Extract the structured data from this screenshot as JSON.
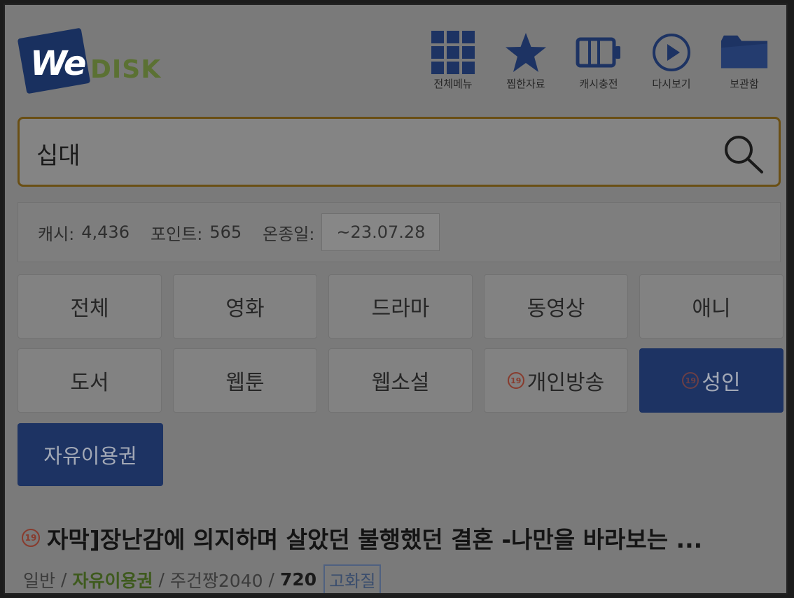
{
  "logo": {
    "we": "We",
    "disk": "DISK"
  },
  "topnav": [
    {
      "label": "전체메뉴",
      "icon": "grid-icon"
    },
    {
      "label": "찜한자료",
      "icon": "star-icon"
    },
    {
      "label": "캐시충전",
      "icon": "battery-icon"
    },
    {
      "label": "다시보기",
      "icon": "play-icon"
    },
    {
      "label": "보관함",
      "icon": "folder-icon"
    }
  ],
  "search": {
    "value": "십대",
    "icon": "search-icon"
  },
  "account": {
    "cash_label": "캐시:",
    "cash_value": "4,436",
    "point_label": "포인트:",
    "point_value": "565",
    "term_label": "온종일:",
    "term_value": "~23.07.28"
  },
  "categories": [
    {
      "label": "전체",
      "age": ""
    },
    {
      "label": "영화",
      "age": ""
    },
    {
      "label": "드라마",
      "age": ""
    },
    {
      "label": "동영상",
      "age": ""
    },
    {
      "label": "애니",
      "age": ""
    },
    {
      "label": "도서",
      "age": ""
    },
    {
      "label": "웹툰",
      "age": ""
    },
    {
      "label": "웹소설",
      "age": ""
    },
    {
      "label": "개인방송",
      "age": "19"
    },
    {
      "label": "성인",
      "age": "19",
      "active": true
    }
  ],
  "free_pass": "자유이용권",
  "result": {
    "age": "19",
    "title": "자막]장난감에 의지하며 살았던 불행했던 결혼 -나만을 바라보는 ...",
    "meta_type": "일반",
    "meta_pass": "자유이용권",
    "meta_uploader": "주건짱2040",
    "meta_count": "720",
    "meta_quality": "고화질"
  },
  "colors": {
    "accent": "#1d3363",
    "search_border": "#6a4f14",
    "logo_green": "#5b7133"
  }
}
